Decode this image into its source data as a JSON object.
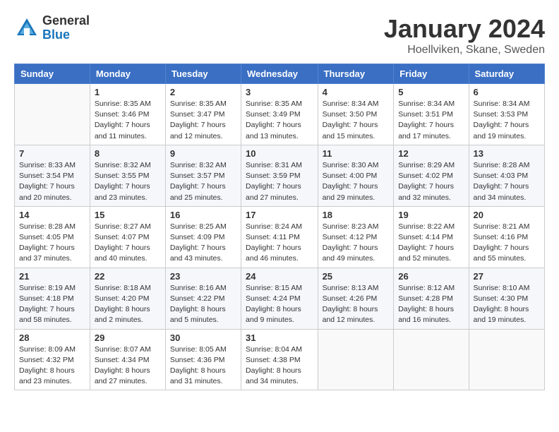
{
  "logo": {
    "general": "General",
    "blue": "Blue"
  },
  "title": {
    "month": "January 2024",
    "location": "Hoellviken, Skane, Sweden"
  },
  "weekdays": [
    "Sunday",
    "Monday",
    "Tuesday",
    "Wednesday",
    "Thursday",
    "Friday",
    "Saturday"
  ],
  "weeks": [
    [
      {
        "day": "",
        "sunrise": "",
        "sunset": "",
        "daylight": ""
      },
      {
        "day": "1",
        "sunrise": "Sunrise: 8:35 AM",
        "sunset": "Sunset: 3:46 PM",
        "daylight": "Daylight: 7 hours and 11 minutes."
      },
      {
        "day": "2",
        "sunrise": "Sunrise: 8:35 AM",
        "sunset": "Sunset: 3:47 PM",
        "daylight": "Daylight: 7 hours and 12 minutes."
      },
      {
        "day": "3",
        "sunrise": "Sunrise: 8:35 AM",
        "sunset": "Sunset: 3:49 PM",
        "daylight": "Daylight: 7 hours and 13 minutes."
      },
      {
        "day": "4",
        "sunrise": "Sunrise: 8:34 AM",
        "sunset": "Sunset: 3:50 PM",
        "daylight": "Daylight: 7 hours and 15 minutes."
      },
      {
        "day": "5",
        "sunrise": "Sunrise: 8:34 AM",
        "sunset": "Sunset: 3:51 PM",
        "daylight": "Daylight: 7 hours and 17 minutes."
      },
      {
        "day": "6",
        "sunrise": "Sunrise: 8:34 AM",
        "sunset": "Sunset: 3:53 PM",
        "daylight": "Daylight: 7 hours and 19 minutes."
      }
    ],
    [
      {
        "day": "7",
        "sunrise": "Sunrise: 8:33 AM",
        "sunset": "Sunset: 3:54 PM",
        "daylight": "Daylight: 7 hours and 20 minutes."
      },
      {
        "day": "8",
        "sunrise": "Sunrise: 8:32 AM",
        "sunset": "Sunset: 3:55 PM",
        "daylight": "Daylight: 7 hours and 23 minutes."
      },
      {
        "day": "9",
        "sunrise": "Sunrise: 8:32 AM",
        "sunset": "Sunset: 3:57 PM",
        "daylight": "Daylight: 7 hours and 25 minutes."
      },
      {
        "day": "10",
        "sunrise": "Sunrise: 8:31 AM",
        "sunset": "Sunset: 3:59 PM",
        "daylight": "Daylight: 7 hours and 27 minutes."
      },
      {
        "day": "11",
        "sunrise": "Sunrise: 8:30 AM",
        "sunset": "Sunset: 4:00 PM",
        "daylight": "Daylight: 7 hours and 29 minutes."
      },
      {
        "day": "12",
        "sunrise": "Sunrise: 8:29 AM",
        "sunset": "Sunset: 4:02 PM",
        "daylight": "Daylight: 7 hours and 32 minutes."
      },
      {
        "day": "13",
        "sunrise": "Sunrise: 8:28 AM",
        "sunset": "Sunset: 4:03 PM",
        "daylight": "Daylight: 7 hours and 34 minutes."
      }
    ],
    [
      {
        "day": "14",
        "sunrise": "Sunrise: 8:28 AM",
        "sunset": "Sunset: 4:05 PM",
        "daylight": "Daylight: 7 hours and 37 minutes."
      },
      {
        "day": "15",
        "sunrise": "Sunrise: 8:27 AM",
        "sunset": "Sunset: 4:07 PM",
        "daylight": "Daylight: 7 hours and 40 minutes."
      },
      {
        "day": "16",
        "sunrise": "Sunrise: 8:25 AM",
        "sunset": "Sunset: 4:09 PM",
        "daylight": "Daylight: 7 hours and 43 minutes."
      },
      {
        "day": "17",
        "sunrise": "Sunrise: 8:24 AM",
        "sunset": "Sunset: 4:11 PM",
        "daylight": "Daylight: 7 hours and 46 minutes."
      },
      {
        "day": "18",
        "sunrise": "Sunrise: 8:23 AM",
        "sunset": "Sunset: 4:12 PM",
        "daylight": "Daylight: 7 hours and 49 minutes."
      },
      {
        "day": "19",
        "sunrise": "Sunrise: 8:22 AM",
        "sunset": "Sunset: 4:14 PM",
        "daylight": "Daylight: 7 hours and 52 minutes."
      },
      {
        "day": "20",
        "sunrise": "Sunrise: 8:21 AM",
        "sunset": "Sunset: 4:16 PM",
        "daylight": "Daylight: 7 hours and 55 minutes."
      }
    ],
    [
      {
        "day": "21",
        "sunrise": "Sunrise: 8:19 AM",
        "sunset": "Sunset: 4:18 PM",
        "daylight": "Daylight: 7 hours and 58 minutes."
      },
      {
        "day": "22",
        "sunrise": "Sunrise: 8:18 AM",
        "sunset": "Sunset: 4:20 PM",
        "daylight": "Daylight: 8 hours and 2 minutes."
      },
      {
        "day": "23",
        "sunrise": "Sunrise: 8:16 AM",
        "sunset": "Sunset: 4:22 PM",
        "daylight": "Daylight: 8 hours and 5 minutes."
      },
      {
        "day": "24",
        "sunrise": "Sunrise: 8:15 AM",
        "sunset": "Sunset: 4:24 PM",
        "daylight": "Daylight: 8 hours and 9 minutes."
      },
      {
        "day": "25",
        "sunrise": "Sunrise: 8:13 AM",
        "sunset": "Sunset: 4:26 PM",
        "daylight": "Daylight: 8 hours and 12 minutes."
      },
      {
        "day": "26",
        "sunrise": "Sunrise: 8:12 AM",
        "sunset": "Sunset: 4:28 PM",
        "daylight": "Daylight: 8 hours and 16 minutes."
      },
      {
        "day": "27",
        "sunrise": "Sunrise: 8:10 AM",
        "sunset": "Sunset: 4:30 PM",
        "daylight": "Daylight: 8 hours and 19 minutes."
      }
    ],
    [
      {
        "day": "28",
        "sunrise": "Sunrise: 8:09 AM",
        "sunset": "Sunset: 4:32 PM",
        "daylight": "Daylight: 8 hours and 23 minutes."
      },
      {
        "day": "29",
        "sunrise": "Sunrise: 8:07 AM",
        "sunset": "Sunset: 4:34 PM",
        "daylight": "Daylight: 8 hours and 27 minutes."
      },
      {
        "day": "30",
        "sunrise": "Sunrise: 8:05 AM",
        "sunset": "Sunset: 4:36 PM",
        "daylight": "Daylight: 8 hours and 31 minutes."
      },
      {
        "day": "31",
        "sunrise": "Sunrise: 8:04 AM",
        "sunset": "Sunset: 4:38 PM",
        "daylight": "Daylight: 8 hours and 34 minutes."
      },
      {
        "day": "",
        "sunrise": "",
        "sunset": "",
        "daylight": ""
      },
      {
        "day": "",
        "sunrise": "",
        "sunset": "",
        "daylight": ""
      },
      {
        "day": "",
        "sunrise": "",
        "sunset": "",
        "daylight": ""
      }
    ]
  ]
}
